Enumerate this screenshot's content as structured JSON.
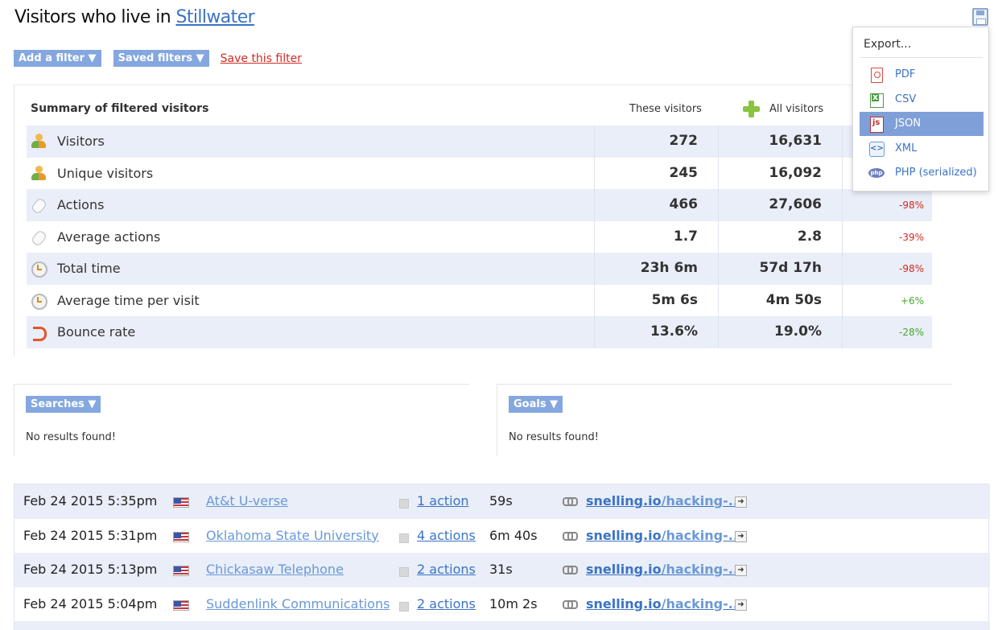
{
  "header": {
    "title_prefix": "Visitors who live in",
    "title_link": "Stillwater"
  },
  "filters": {
    "add_filter": "Add a filter ▼",
    "saved_filters": "Saved filters ▼",
    "save_filter": "Save this filter"
  },
  "summary": {
    "title": "Summary of filtered visitors",
    "col_these": "These visitors",
    "col_all": "All visitors",
    "rows": [
      {
        "label": "Visitors",
        "these": "272",
        "all": "16,631",
        "pct": ""
      },
      {
        "label": "Unique visitors",
        "these": "245",
        "all": "16,092",
        "pct": ""
      },
      {
        "label": "Actions",
        "these": "466",
        "all": "27,606",
        "pct": "-98%"
      },
      {
        "label": "Average actions",
        "these": "1.7",
        "all": "2.8",
        "pct": "-39%"
      },
      {
        "label": "Total time",
        "these": "23h 6m",
        "all": "57d 17h",
        "pct": "-98%"
      },
      {
        "label": "Average time per visit",
        "these": "5m 6s",
        "all": "4m 50s",
        "pct": "+6%"
      },
      {
        "label": "Bounce rate",
        "these": "13.6%",
        "all": "19.0%",
        "pct": "-28%"
      }
    ]
  },
  "searches": {
    "button": "Searches ▼",
    "empty": "No results found!"
  },
  "goals": {
    "button": "Goals ▼",
    "empty": "No results found!"
  },
  "visits": [
    {
      "date": "Feb 24 2015 5:35pm",
      "isp": "At&t U-verse",
      "actions": "1 action",
      "duration": "59s",
      "url_domain": "snelling.io",
      "url_path": "/hacking-..."
    },
    {
      "date": "Feb 24 2015 5:31pm",
      "isp": "Oklahoma State University",
      "actions": "4 actions",
      "duration": "6m 40s",
      "url_domain": "snelling.io",
      "url_path": "/hacking-..."
    },
    {
      "date": "Feb 24 2015 5:13pm",
      "isp": "Chickasaw Telephone",
      "actions": "2 actions",
      "duration": "31s",
      "url_domain": "snelling.io",
      "url_path": "/hacking-..."
    },
    {
      "date": "Feb 24 2015 5:04pm",
      "isp": "Suddenlink Communications",
      "actions": "2 actions",
      "duration": "10m 2s",
      "url_domain": "snelling.io",
      "url_path": "/hacking-..."
    }
  ],
  "export_menu": {
    "heading": "Export...",
    "items": [
      {
        "label": "PDF",
        "icon": "pdf-icon"
      },
      {
        "label": "CSV",
        "icon": "csv-icon"
      },
      {
        "label": "JSON",
        "icon": "json-icon",
        "active": true
      },
      {
        "label": "XML",
        "icon": "xml-icon"
      },
      {
        "label": "PHP (serialized)",
        "icon": "php-icon"
      }
    ]
  },
  "colors": {
    "accent": "#3b73c5",
    "pill": "#84a7df",
    "row_shade": "#e9eef8",
    "negative": "#d12b20",
    "positive": "#46a52b"
  }
}
